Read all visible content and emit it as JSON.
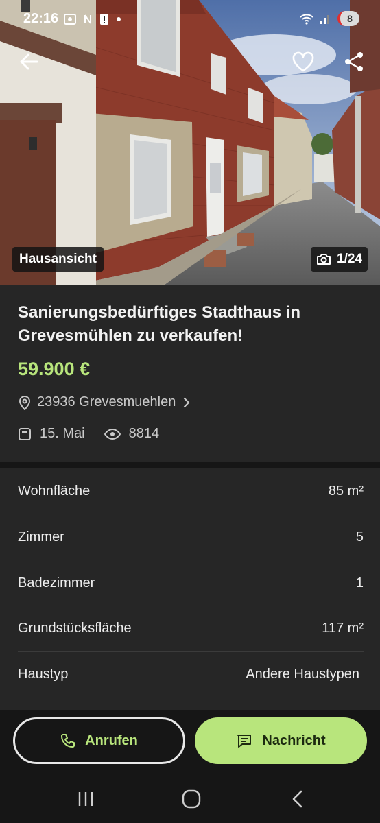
{
  "status_bar": {
    "time": "22:16",
    "battery_level": "8",
    "icons": [
      "screenshot-icon",
      "nfc-icon",
      "alert-icon",
      "dot-icon",
      "wifi-icon",
      "signal-icon",
      "battery-icon"
    ]
  },
  "top_bar": {
    "icons": [
      "back-arrow-icon",
      "heart-icon",
      "share-icon"
    ]
  },
  "gallery": {
    "label": "Hausansicht",
    "counter": "1/24"
  },
  "listing": {
    "title": "Sanierungsbedürftiges Stadthaus in Grevesmühlen zu verkaufen!",
    "price": "59.900 €",
    "location": "23936 Grevesmuehlen",
    "date": "15. Mai",
    "views": "8814"
  },
  "details": [
    {
      "label": "Wohnfläche",
      "value": "85 m²"
    },
    {
      "label": "Zimmer",
      "value": "5"
    },
    {
      "label": "Badezimmer",
      "value": "1"
    },
    {
      "label": "Grundstücksfläche",
      "value": "117 m²"
    },
    {
      "label": "Haustyp",
      "value": "Andere Haustypen"
    }
  ],
  "actions": {
    "call_label": "Anrufen",
    "message_label": "Nachricht"
  },
  "nav_bar": {
    "icons": [
      "recent-apps-icon",
      "home-icon",
      "nav-back-icon"
    ]
  },
  "colors": {
    "accent": "#b8e57c",
    "background": "#262626",
    "dark": "#161616"
  }
}
